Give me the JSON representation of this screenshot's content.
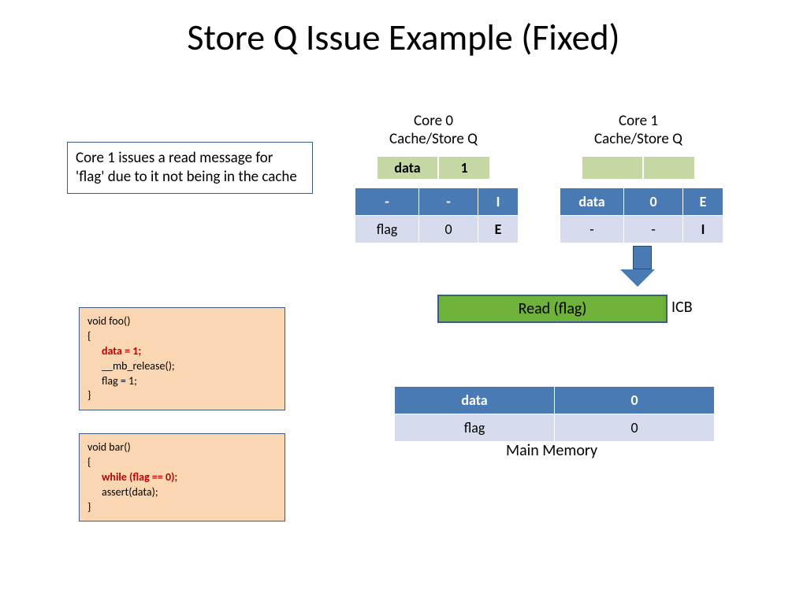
{
  "title": "Store Q Issue Example (Fixed)",
  "note": "Core 1 issues a read message for 'flag' due to it not being in the cache",
  "code_foo": {
    "sig": "void foo()",
    "open": "{",
    "l1": "data = 1;",
    "l2": "__mb_release();",
    "l3": "flag = 1;",
    "close": "}"
  },
  "code_bar": {
    "sig": "void bar()",
    "open": "{",
    "l1": "while (flag == 0);",
    "l2": "assert(data);",
    "close": "}"
  },
  "core0": {
    "label_line1": "Core 0",
    "label_line2": "Cache/Store Q",
    "storeq": {
      "c0": "data",
      "c1": "1"
    },
    "row0": {
      "c0": "-",
      "c1": "-",
      "c2": "I"
    },
    "row1": {
      "c0": "flag",
      "c1": "0",
      "c2": "E"
    }
  },
  "core1": {
    "label_line1": "Core 1",
    "label_line2": "Cache/Store Q",
    "storeq": {
      "c0": "",
      "c1": ""
    },
    "row0": {
      "c0": "data",
      "c1": "0",
      "c2": "E"
    },
    "row1": {
      "c0": "-",
      "c1": "-",
      "c2": "I"
    }
  },
  "icb": {
    "bar": "Read (flag)",
    "label": "ICB"
  },
  "memory": {
    "row0": {
      "c0": "data",
      "c1": "0"
    },
    "row1": {
      "c0": "flag",
      "c1": "0"
    },
    "label": "Main Memory"
  }
}
